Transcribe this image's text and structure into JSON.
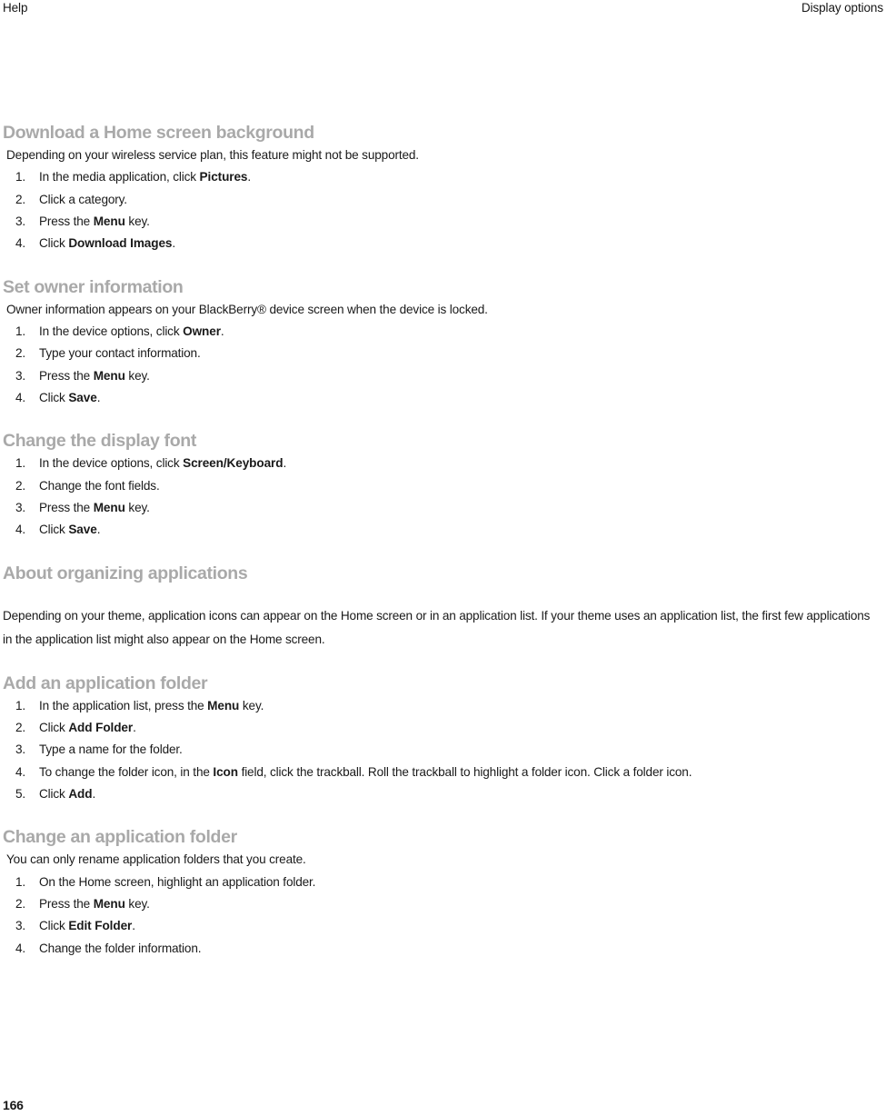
{
  "header": {
    "left": "Help",
    "right": "Display options"
  },
  "sections": [
    {
      "title": "Download a Home screen background",
      "intro": "Depending on your wireless service plan, this feature might not be supported.",
      "steps": [
        {
          "num": "1.",
          "parts": [
            {
              "t": "In the media application, click ",
              "b": false
            },
            {
              "t": "Pictures",
              "b": true
            },
            {
              "t": ".",
              "b": false
            }
          ]
        },
        {
          "num": "2.",
          "parts": [
            {
              "t": "Click a category.",
              "b": false
            }
          ]
        },
        {
          "num": "3.",
          "parts": [
            {
              "t": "Press the ",
              "b": false
            },
            {
              "t": "Menu",
              "b": true
            },
            {
              "t": " key.",
              "b": false
            }
          ]
        },
        {
          "num": "4.",
          "parts": [
            {
              "t": "Click ",
              "b": false
            },
            {
              "t": "Download Images",
              "b": true
            },
            {
              "t": ".",
              "b": false
            }
          ]
        }
      ]
    },
    {
      "title": "Set owner information",
      "intro": "Owner information appears on your BlackBerry® device screen when the device is locked.",
      "steps": [
        {
          "num": "1.",
          "parts": [
            {
              "t": "In the device options, click ",
              "b": false
            },
            {
              "t": "Owner",
              "b": true
            },
            {
              "t": ".",
              "b": false
            }
          ]
        },
        {
          "num": "2.",
          "parts": [
            {
              "t": "Type your contact information.",
              "b": false
            }
          ]
        },
        {
          "num": "3.",
          "parts": [
            {
              "t": "Press the ",
              "b": false
            },
            {
              "t": "Menu",
              "b": true
            },
            {
              "t": " key.",
              "b": false
            }
          ]
        },
        {
          "num": "4.",
          "parts": [
            {
              "t": "Click ",
              "b": false
            },
            {
              "t": "Save",
              "b": true
            },
            {
              "t": ".",
              "b": false
            }
          ]
        }
      ]
    },
    {
      "title": "Change the display font",
      "intro": "",
      "steps": [
        {
          "num": "1.",
          "parts": [
            {
              "t": "In the device options, click ",
              "b": false
            },
            {
              "t": "Screen/Keyboard",
              "b": true
            },
            {
              "t": ".",
              "b": false
            }
          ]
        },
        {
          "num": "2.",
          "parts": [
            {
              "t": "Change the font fields.",
              "b": false
            }
          ]
        },
        {
          "num": "3.",
          "parts": [
            {
              "t": "Press the ",
              "b": false
            },
            {
              "t": "Menu",
              "b": true
            },
            {
              "t": " key.",
              "b": false
            }
          ]
        },
        {
          "num": "4.",
          "parts": [
            {
              "t": "Click ",
              "b": false
            },
            {
              "t": "Save",
              "b": true
            },
            {
              "t": ".",
              "b": false
            }
          ]
        }
      ]
    },
    {
      "title": "About organizing applications",
      "paragraph": "Depending on your theme, application icons can appear on the Home screen or in an application list. If your theme uses an application list, the first few applications in the application list might also appear on the Home screen.",
      "steps": []
    },
    {
      "title": "Add an application folder",
      "intro": "",
      "steps": [
        {
          "num": "1.",
          "parts": [
            {
              "t": "In the application list, press the ",
              "b": false
            },
            {
              "t": "Menu",
              "b": true
            },
            {
              "t": " key.",
              "b": false
            }
          ]
        },
        {
          "num": "2.",
          "parts": [
            {
              "t": "Click ",
              "b": false
            },
            {
              "t": "Add Folder",
              "b": true
            },
            {
              "t": ".",
              "b": false
            }
          ]
        },
        {
          "num": "3.",
          "parts": [
            {
              "t": "Type a name for the folder.",
              "b": false
            }
          ]
        },
        {
          "num": "4.",
          "parts": [
            {
              "t": "To change the folder icon, in the ",
              "b": false
            },
            {
              "t": "Icon",
              "b": true
            },
            {
              "t": " field, click the trackball. Roll the trackball to highlight a folder icon. Click a folder icon.",
              "b": false
            }
          ]
        },
        {
          "num": "5.",
          "parts": [
            {
              "t": "Click ",
              "b": false
            },
            {
              "t": "Add",
              "b": true
            },
            {
              "t": ".",
              "b": false
            }
          ]
        }
      ]
    },
    {
      "title": "Change an application folder",
      "intro": "You can only rename application folders that you create.",
      "steps": [
        {
          "num": "1.",
          "parts": [
            {
              "t": "On the Home screen, highlight an application folder.",
              "b": false
            }
          ]
        },
        {
          "num": "2.",
          "parts": [
            {
              "t": "Press the ",
              "b": false
            },
            {
              "t": "Menu",
              "b": true
            },
            {
              "t": " key.",
              "b": false
            }
          ]
        },
        {
          "num": "3.",
          "parts": [
            {
              "t": "Click ",
              "b": false
            },
            {
              "t": "Edit Folder",
              "b": true
            },
            {
              "t": ".",
              "b": false
            }
          ]
        },
        {
          "num": "4.",
          "parts": [
            {
              "t": "Change the folder information.",
              "b": false
            }
          ]
        }
      ]
    }
  ],
  "footer": {
    "page_number": "166"
  }
}
